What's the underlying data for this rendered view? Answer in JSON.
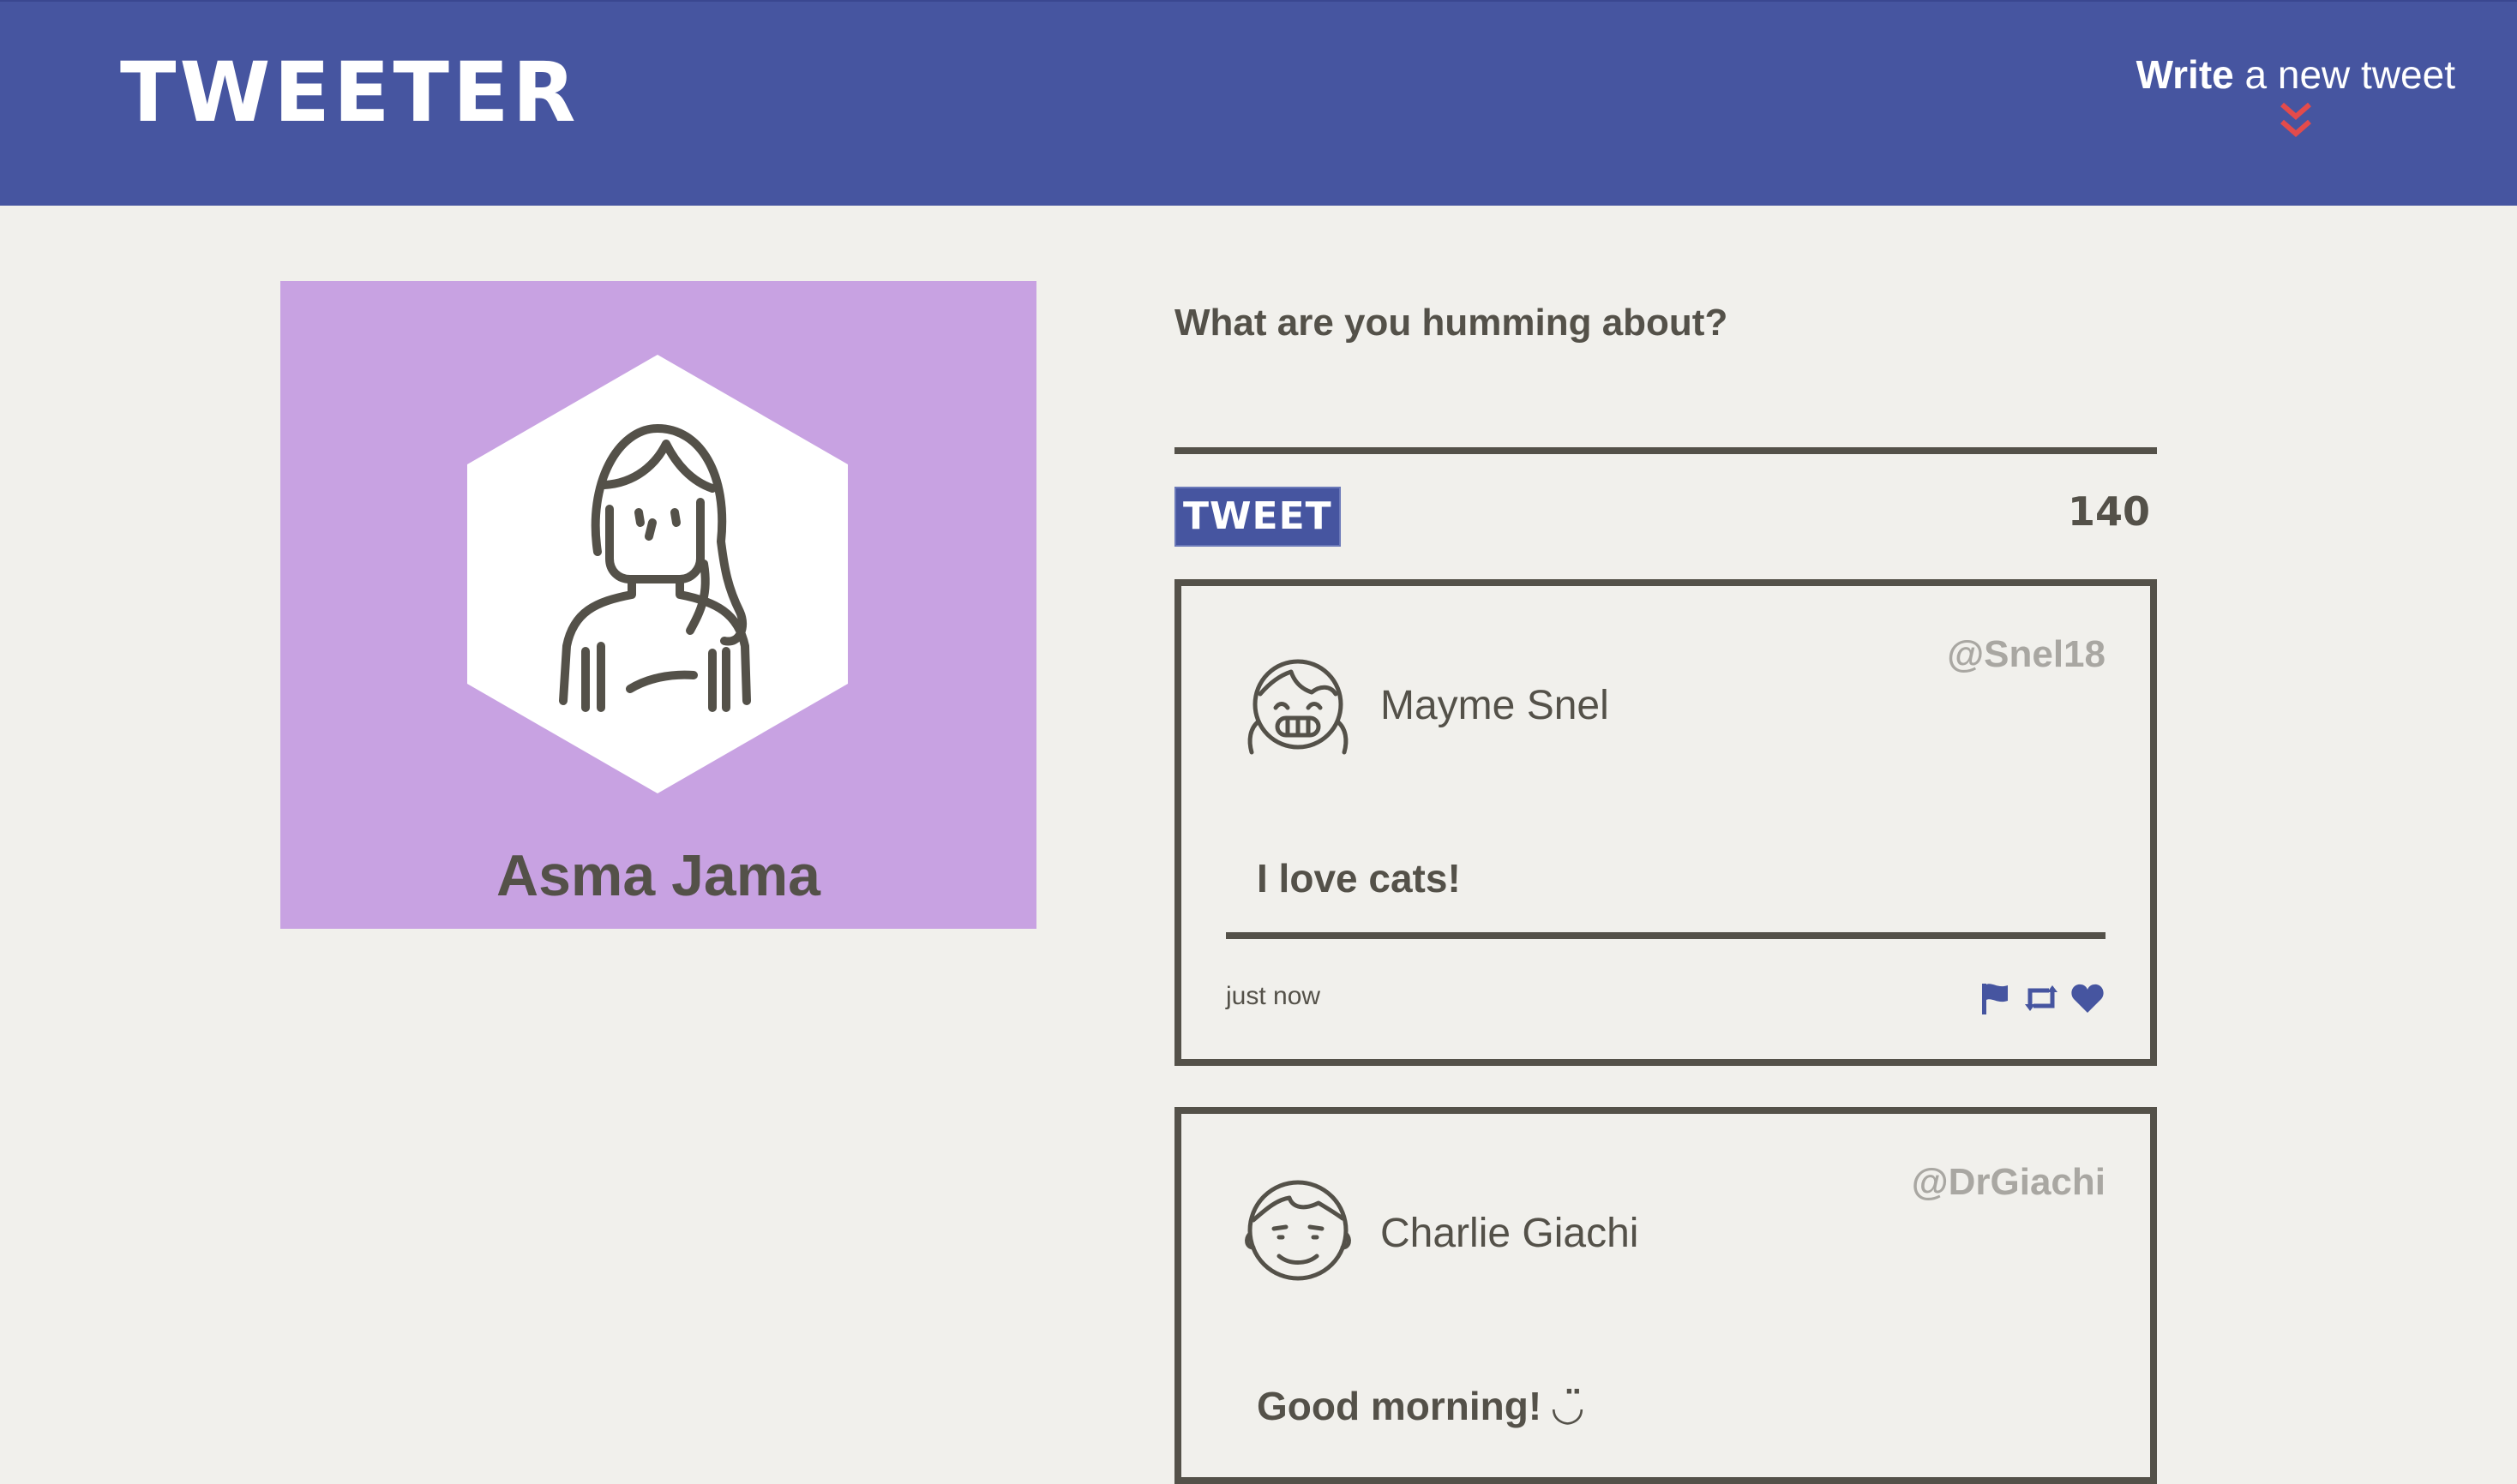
{
  "nav": {
    "brand": "TWEETER",
    "compose_strong": "Write",
    "compose_rest": " a new tweet",
    "compose_icon": "double-chevron-down-icon",
    "compose_icon_color": "#e34b4b"
  },
  "colors": {
    "nav_bg": "#4655a0",
    "page_bg": "#f1f0ec",
    "text": "#545149",
    "profile_bg": "#c8a2e2",
    "handle": "#a9a7a2"
  },
  "profile": {
    "name": "Asma Jama",
    "avatar_icon": "woman-avatar-icon"
  },
  "composer": {
    "placeholder": "What are you humming about?",
    "button_label": "TWEET",
    "counter": "140"
  },
  "tweets": [
    {
      "name": "Mayme Snel",
      "handle": "@Snel18",
      "content": "I love cats!",
      "time": "just now",
      "avatar_icon": "girl-avatar-icon",
      "actions": [
        "flag-icon",
        "retweet-icon",
        "heart-icon"
      ]
    },
    {
      "name": "Charlie Giachi",
      "handle": "@DrGiachi",
      "content": "Good morning! ◡̈",
      "avatar_icon": "man-avatar-icon"
    }
  ]
}
